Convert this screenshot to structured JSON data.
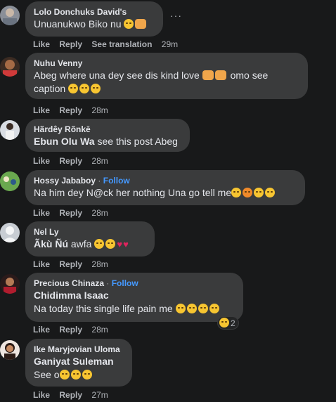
{
  "comments": [
    {
      "author": "Lolo Donchuks David's",
      "text": "Unuanukwo Biko nu",
      "like": "Like",
      "reply": "Reply",
      "translate": "See translation",
      "time": "29m"
    },
    {
      "author": "Nuhu Venny",
      "text": "Abeg where una dey see dis kind love",
      "text2": "omo see",
      "text3": "caption",
      "like": "Like",
      "reply": "Reply",
      "time": "28m"
    },
    {
      "author": "Hãrdêy Rõnkē",
      "tag": "Ebun Olu Wa",
      "text": "see this post Abeg",
      "like": "Like",
      "reply": "Reply",
      "time": "28m"
    },
    {
      "author": "Hossy Jababoy",
      "follow": "Follow",
      "text": "Na him dey N@ck her nothing Una go tell me",
      "like": "Like",
      "reply": "Reply",
      "time": "28m"
    },
    {
      "author": "Nel Ly",
      "tag": "Ãkù Ñú",
      "text": "awfa",
      "like": "Like",
      "reply": "Reply",
      "time": "28m"
    },
    {
      "author": "Precious Chinaza",
      "follow": "Follow",
      "tag": "Chidimma Isaac",
      "text": "Na today this single life pain me",
      "reactions": "2",
      "like": "Like",
      "reply": "Reply",
      "time": "28m"
    },
    {
      "author": "Ike Maryjovian Uloma",
      "tag": "Ganiyat Suleman",
      "text": "See o",
      "like": "Like",
      "reply": "Reply",
      "time": "27m"
    }
  ],
  "separator": "·",
  "more_icon": "ellipsis-icon",
  "colors": {
    "background": "#18191a",
    "bubble": "#3a3b3c",
    "follow": "#4599ff",
    "secondary": "#b0b3b8"
  }
}
